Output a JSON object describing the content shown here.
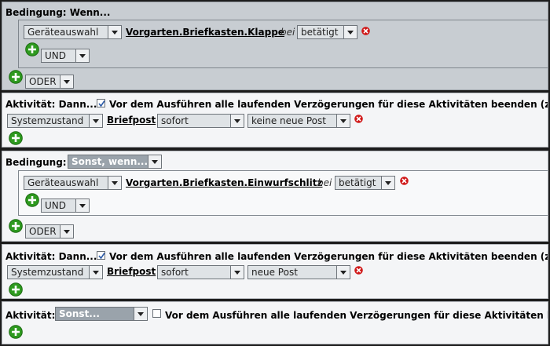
{
  "section1": {
    "title": "Bedingung: Wenn...",
    "device_select": "Geräteauswahl",
    "device_link": "Vorgarten.Briefkasten.Klappe",
    "bei": "bei",
    "state_select": "betätigt",
    "logic_select": "UND",
    "outer_logic_select": "ODER"
  },
  "activity1": {
    "title": "Aktivität: Dann...",
    "checkbox_checked": true,
    "checkbox_label": "Vor dem Ausführen alle laufenden Verzögerungen für diese Aktivitäten beenden (z.B",
    "type_select": "Systemzustand",
    "link": "Briefpost",
    "timing_select": "sofort",
    "value_select": "keine neue Post"
  },
  "section2": {
    "title_label": "Bedingung:",
    "title_select": "Sonst, wenn...",
    "device_select": "Geräteauswahl",
    "device_link": "Vorgarten.Briefkasten.Einwurfschlitz",
    "bei": "bei",
    "state_select": "betätigt",
    "logic_select": "UND",
    "outer_logic_select": "ODER"
  },
  "activity2": {
    "title": "Aktivität: Dann...",
    "checkbox_checked": true,
    "checkbox_label": "Vor dem Ausführen alle laufenden Verzögerungen für diese Aktivitäten beenden (z.B",
    "type_select": "Systemzustand",
    "link": "Briefpost",
    "timing_select": "sofort",
    "value_select": "neue Post"
  },
  "activity3": {
    "title_label": "Aktivität:",
    "title_select": "Sonst...",
    "checkbox_checked": false,
    "checkbox_label": "Vor dem Ausführen alle laufenden Verzögerungen für diese Aktivitäten beend"
  },
  "icons": {
    "add": "green-plus-icon",
    "delete": "red-x-icon",
    "dropdown": "chevron-down-icon"
  },
  "colors": {
    "panel_grey": "#c8cdd2",
    "panel_white": "#f4f5f7",
    "add_green": "#2e9a1f",
    "delete_red": "#d01818"
  }
}
